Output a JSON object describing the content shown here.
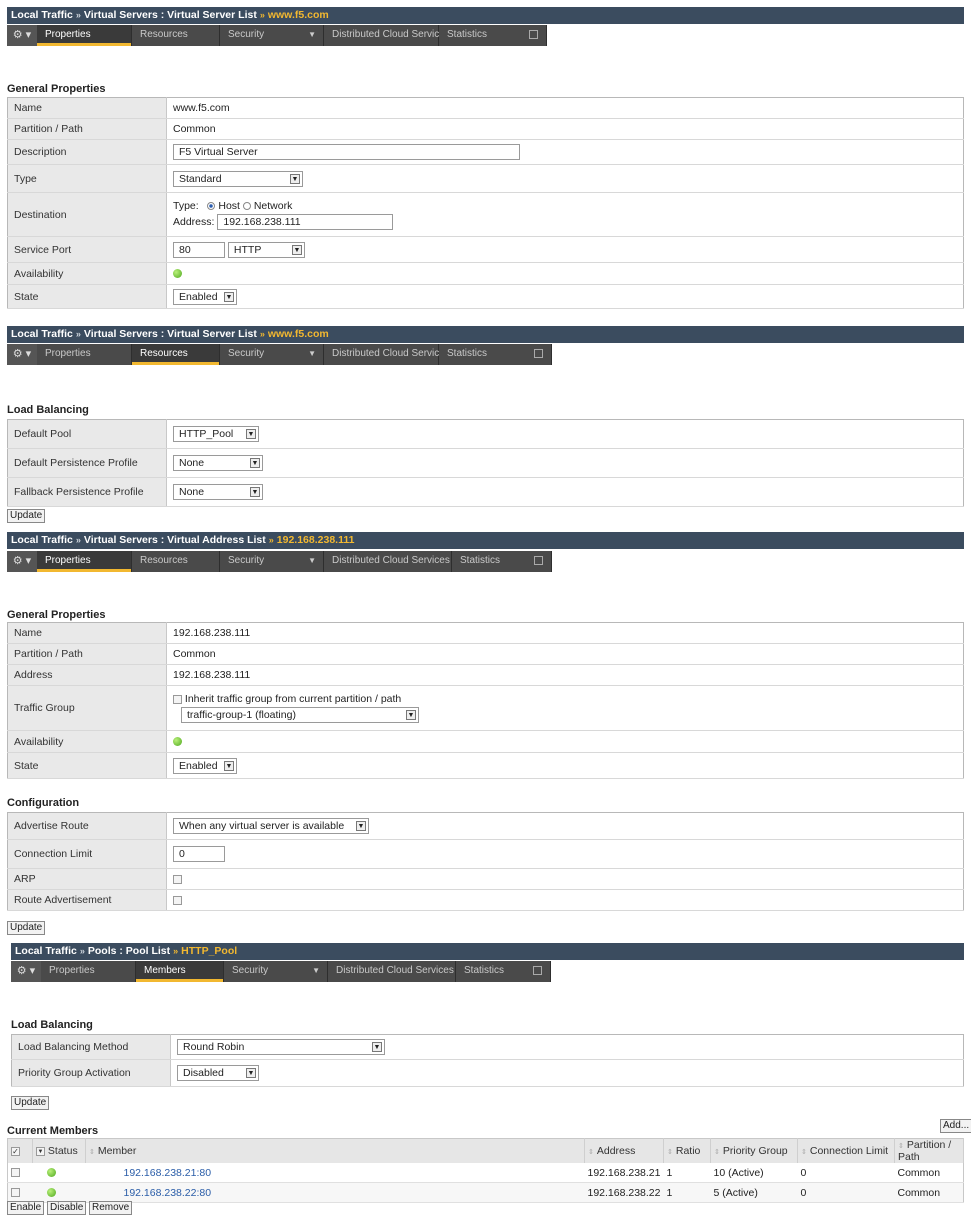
{
  "virtual_server_props": {
    "breadcrumb": {
      "a": "Local Traffic",
      "b": "Virtual Servers : Virtual Server List",
      "current": "www.f5.com"
    },
    "tabs": [
      "Properties",
      "Resources",
      "Security",
      "Distributed Cloud Services",
      "Statistics"
    ],
    "section": "General Properties",
    "rows": {
      "name_label": "Name",
      "name_value": "www.f5.com",
      "partition_label": "Partition / Path",
      "partition_value": "Common",
      "description_label": "Description",
      "description_value": "F5 Virtual Server",
      "type_label": "Type",
      "type_value": "Standard",
      "destination_label": "Destination",
      "dest_type_label": "Type:",
      "dest_host": "Host",
      "dest_network": "Network",
      "dest_address_label": "Address:",
      "dest_address_value": "192.168.238.111",
      "port_label": "Service Port",
      "port_value": "80",
      "port_protocol": "HTTP",
      "availability_label": "Availability",
      "state_label": "State",
      "state_value": "Enabled"
    }
  },
  "virtual_server_resources": {
    "breadcrumb": {
      "a": "Local Traffic",
      "b": "Virtual Servers : Virtual Server List",
      "current": "www.f5.com"
    },
    "section": "Load Balancing",
    "rows": {
      "pool_label": "Default Pool",
      "pool_value": "HTTP_Pool",
      "persist_label": "Default Persistence Profile",
      "persist_value": "None",
      "fallback_label": "Fallback Persistence Profile",
      "fallback_value": "None"
    },
    "update": "Update"
  },
  "virtual_address": {
    "breadcrumb": {
      "a": "Local Traffic",
      "b": "Virtual Servers : Virtual Address List",
      "current": "192.168.238.111"
    },
    "section": "General Properties",
    "rows": {
      "name_label": "Name",
      "name_value": "192.168.238.111",
      "partition_label": "Partition / Path",
      "partition_value": "Common",
      "address_label": "Address",
      "address_value": "192.168.238.111",
      "tg_label": "Traffic Group",
      "tg_inherit": "Inherit traffic group from current partition / path",
      "tg_value": "traffic-group-1 (floating)",
      "availability_label": "Availability",
      "state_label": "State",
      "state_value": "Enabled"
    },
    "config_section": "Configuration",
    "config": {
      "advertise_label": "Advertise Route",
      "advertise_value": "When any virtual server is available",
      "connlimit_label": "Connection Limit",
      "connlimit_value": "0",
      "arp_label": "ARP",
      "route_adv_label": "Route Advertisement"
    },
    "update": "Update"
  },
  "pool": {
    "breadcrumb": {
      "a": "Local Traffic",
      "b": "Pools : Pool List",
      "current": "HTTP_Pool"
    },
    "tabs": [
      "Properties",
      "Members",
      "Security",
      "Distributed Cloud Services",
      "Statistics"
    ],
    "section": "Load Balancing",
    "rows": {
      "method_label": "Load Balancing Method",
      "method_value": "Round Robin",
      "pga_label": "Priority Group Activation",
      "pga_value": "Disabled"
    },
    "update": "Update",
    "members_title": "Current Members",
    "add": "Add...",
    "columns": {
      "status": "Status",
      "member": "Member",
      "address": "Address",
      "ratio": "Ratio",
      "priority": "Priority Group",
      "connlimit": "Connection Limit",
      "partition": "Partition / Path"
    },
    "members": [
      {
        "member": "192.168.238.21:80",
        "address": "192.168.238.21",
        "ratio": "1",
        "priority": "10 (Active)",
        "connlimit": "0",
        "partition": "Common"
      },
      {
        "member": "192.168.238.22:80",
        "address": "192.168.238.22",
        "ratio": "1",
        "priority": "5 (Active)",
        "connlimit": "0",
        "partition": "Common"
      }
    ],
    "actions": [
      "Enable",
      "Disable",
      "Remove"
    ]
  }
}
